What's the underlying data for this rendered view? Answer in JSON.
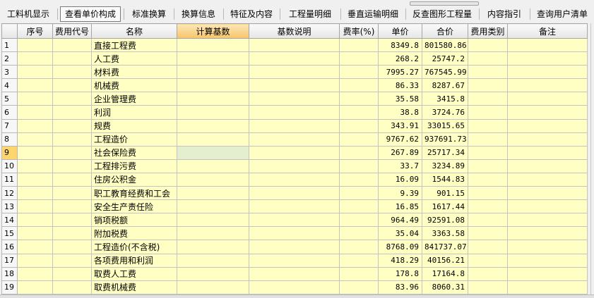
{
  "tabs": [
    {
      "label": "工料机显示",
      "active": false
    },
    {
      "label": "查看单价构成",
      "active": true
    },
    {
      "label": "标准换算",
      "active": false
    },
    {
      "label": "换算信息",
      "active": false
    },
    {
      "label": "特征及内容",
      "active": false
    },
    {
      "label": "工程量明细",
      "active": false
    },
    {
      "label": "垂直运输明细",
      "active": false
    },
    {
      "label": "反查图形工程量",
      "active": false
    },
    {
      "label": "内容指引",
      "active": false
    },
    {
      "label": "查询用户清单",
      "active": false
    }
  ],
  "columns": [
    "序号",
    "费用代号",
    "名称",
    "计算基数",
    "基数说明",
    "费率(%)",
    "单价",
    "合价",
    "费用类别",
    "备注"
  ],
  "highlighted_column": "计算基数",
  "selected_row": "9",
  "rows": [
    {
      "n": "1",
      "name": "直接工程费",
      "price": "8349.8",
      "total": "801580.86"
    },
    {
      "n": "2",
      "name": "人工费",
      "price": "268.2",
      "total": "25747.2"
    },
    {
      "n": "3",
      "name": "材料费",
      "price": "7995.27",
      "total": "767545.99"
    },
    {
      "n": "4",
      "name": "机械费",
      "price": "86.33",
      "total": "8287.67"
    },
    {
      "n": "5",
      "name": "企业管理费",
      "price": "35.58",
      "total": "3415.8"
    },
    {
      "n": "6",
      "name": "利润",
      "price": "38.8",
      "total": "3724.76"
    },
    {
      "n": "7",
      "name": "规费",
      "price": "343.91",
      "total": "33015.65"
    },
    {
      "n": "8",
      "name": "工程造价",
      "price": "9767.62",
      "total": "937691.73"
    },
    {
      "n": "9",
      "name": "社会保险费",
      "price": "267.89",
      "total": "25717.34"
    },
    {
      "n": "10",
      "name": "工程排污费",
      "price": "33.7",
      "total": "3234.89"
    },
    {
      "n": "11",
      "name": "住房公积金",
      "price": "16.09",
      "total": "1544.83"
    },
    {
      "n": "12",
      "name": "职工教育经费和工会",
      "price": "9.39",
      "total": "901.15"
    },
    {
      "n": "13",
      "name": "安全生产责任险",
      "price": "16.85",
      "total": "1617.44"
    },
    {
      "n": "14",
      "name": "销项税额",
      "price": "964.49",
      "total": "92591.08"
    },
    {
      "n": "15",
      "name": "附加税费",
      "price": "35.04",
      "total": "3363.58"
    },
    {
      "n": "16",
      "name": "工程造价(不含税)",
      "price": "8768.09",
      "total": "841737.07"
    },
    {
      "n": "17",
      "name": "各项费用和利润",
      "price": "418.29",
      "total": "40156.21"
    },
    {
      "n": "18",
      "name": "取费人工费",
      "price": "178.8",
      "total": "17164.8"
    },
    {
      "n": "19",
      "name": "取费机械费",
      "price": "83.96",
      "total": "8060.31"
    }
  ]
}
